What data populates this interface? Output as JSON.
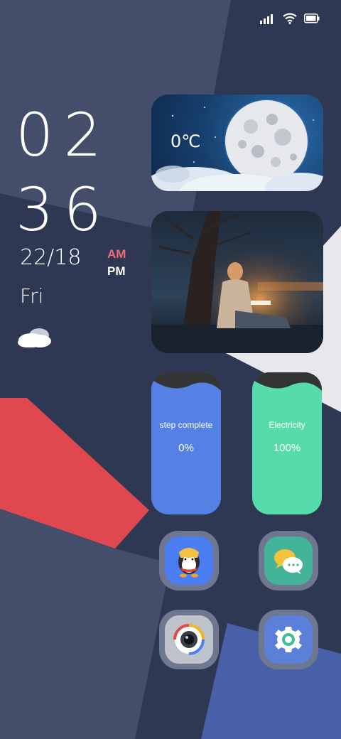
{
  "status_bar": {
    "icons": [
      "signal-icon",
      "wifi-icon",
      "battery-icon"
    ]
  },
  "clock": {
    "hour": "02",
    "minute": "36",
    "date": "22/18",
    "am": "AM",
    "pm": "PM",
    "day": "Fri"
  },
  "weather_widget": {
    "temperature": "0℃",
    "icon": "moon-icon"
  },
  "step_card": {
    "label": "step complete",
    "value": "0%"
  },
  "electricity_card": {
    "label": "Electricity",
    "value": "100%"
  },
  "apps": [
    {
      "icon": "qq-icon"
    },
    {
      "icon": "wechat-icon"
    },
    {
      "icon": "camera-icon"
    },
    {
      "icon": "settings-icon"
    }
  ],
  "colors": {
    "background": "#2e3853",
    "red_shape": "#e0484f",
    "step_card": "#5581e4",
    "electricity_card": "#56dcaa",
    "am": "#f06a70"
  }
}
